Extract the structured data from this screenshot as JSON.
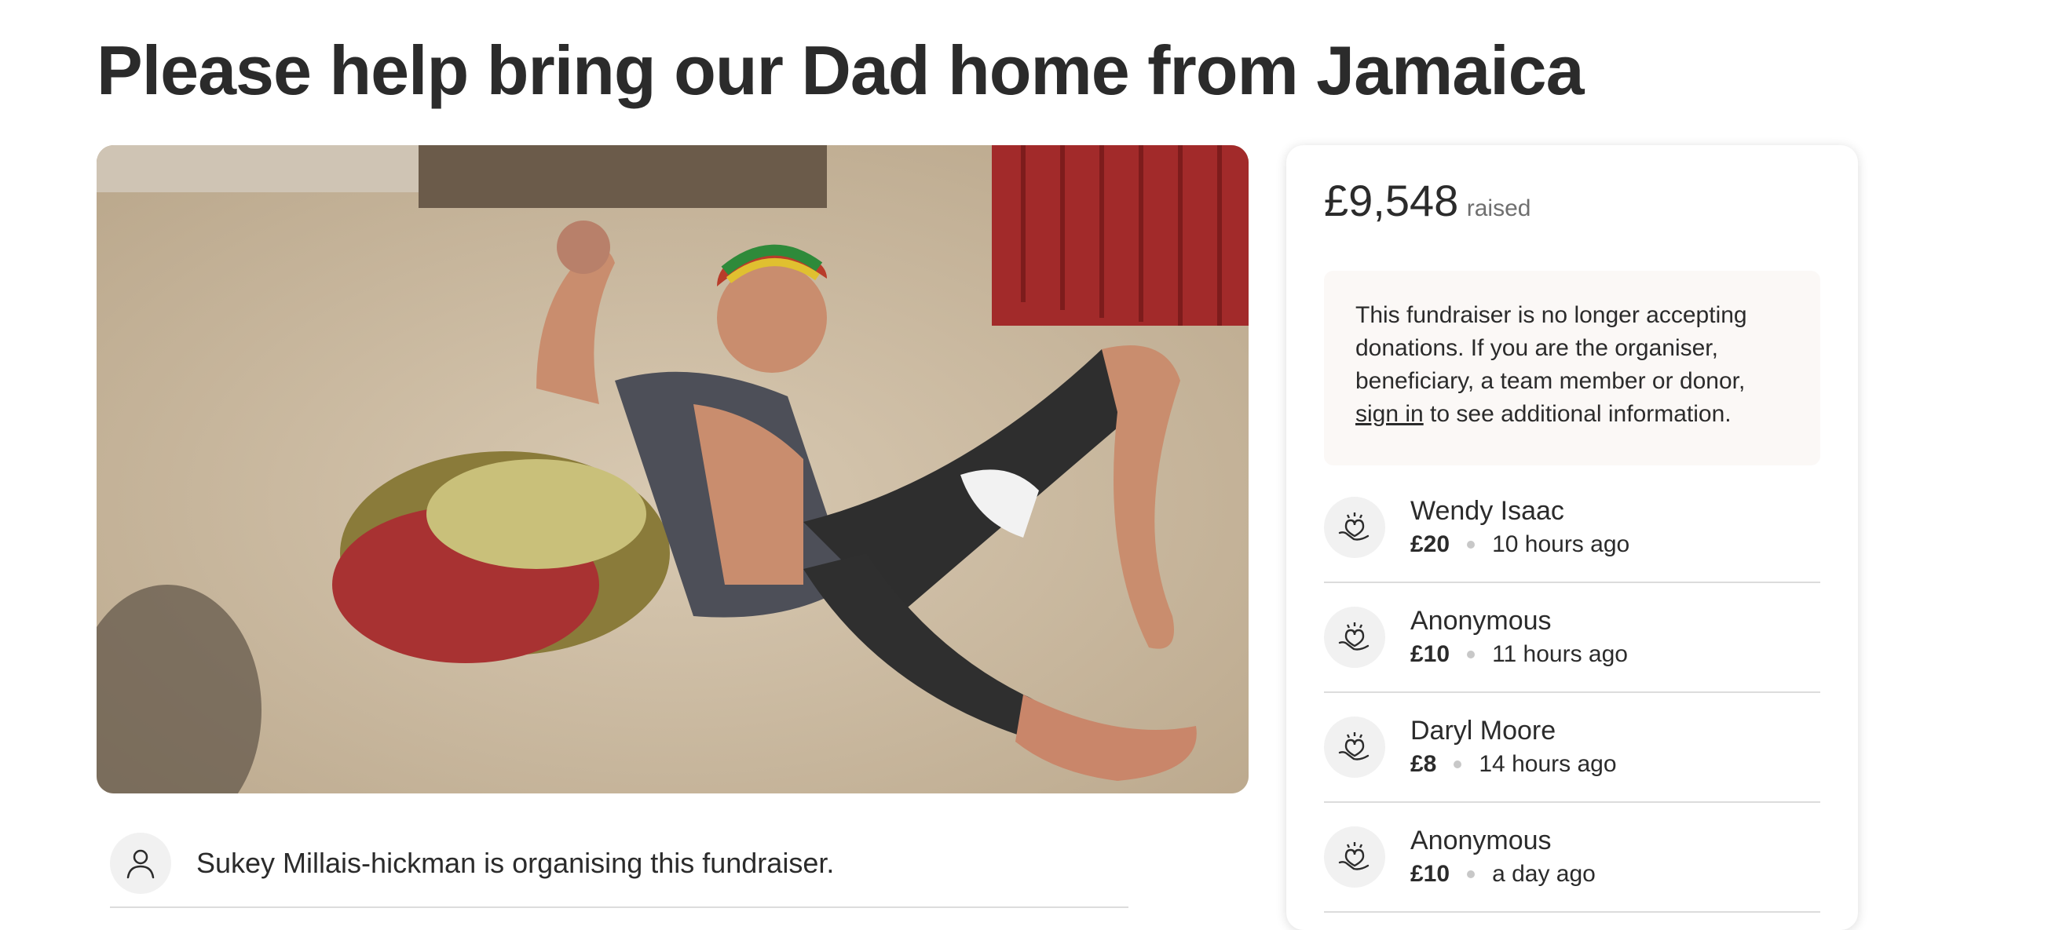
{
  "page": {
    "title": "Please help bring our Dad home from Jamaica"
  },
  "organiser": {
    "text": "Sukey Millais-hickman is organising this fundraiser.",
    "avatar_icon": "user-icon"
  },
  "progress": {
    "amount": "£9,548",
    "label": "raised"
  },
  "notice": {
    "text_before": "This fundraiser is no longer accepting donations. If you are the organiser, beneficiary, a team member or donor, ",
    "link": "sign in",
    "text_after": " to see additional information."
  },
  "donations": [
    {
      "name": "Wendy Isaac",
      "amount": "£20",
      "time": "10 hours ago",
      "icon": "heart-hands-icon"
    },
    {
      "name": "Anonymous",
      "amount": "£10",
      "time": "11 hours ago",
      "icon": "heart-hands-icon"
    },
    {
      "name": "Daryl Moore",
      "amount": "£8",
      "time": "14 hours ago",
      "icon": "heart-hands-icon"
    },
    {
      "name": "Anonymous",
      "amount": "£10",
      "time": "a day ago",
      "icon": "heart-hands-icon"
    }
  ],
  "colors": {
    "text": "#2b2b2b",
    "muted": "#6f6f6f",
    "notice_bg": "#fbf8f6",
    "divider": "#dcdcdc"
  }
}
